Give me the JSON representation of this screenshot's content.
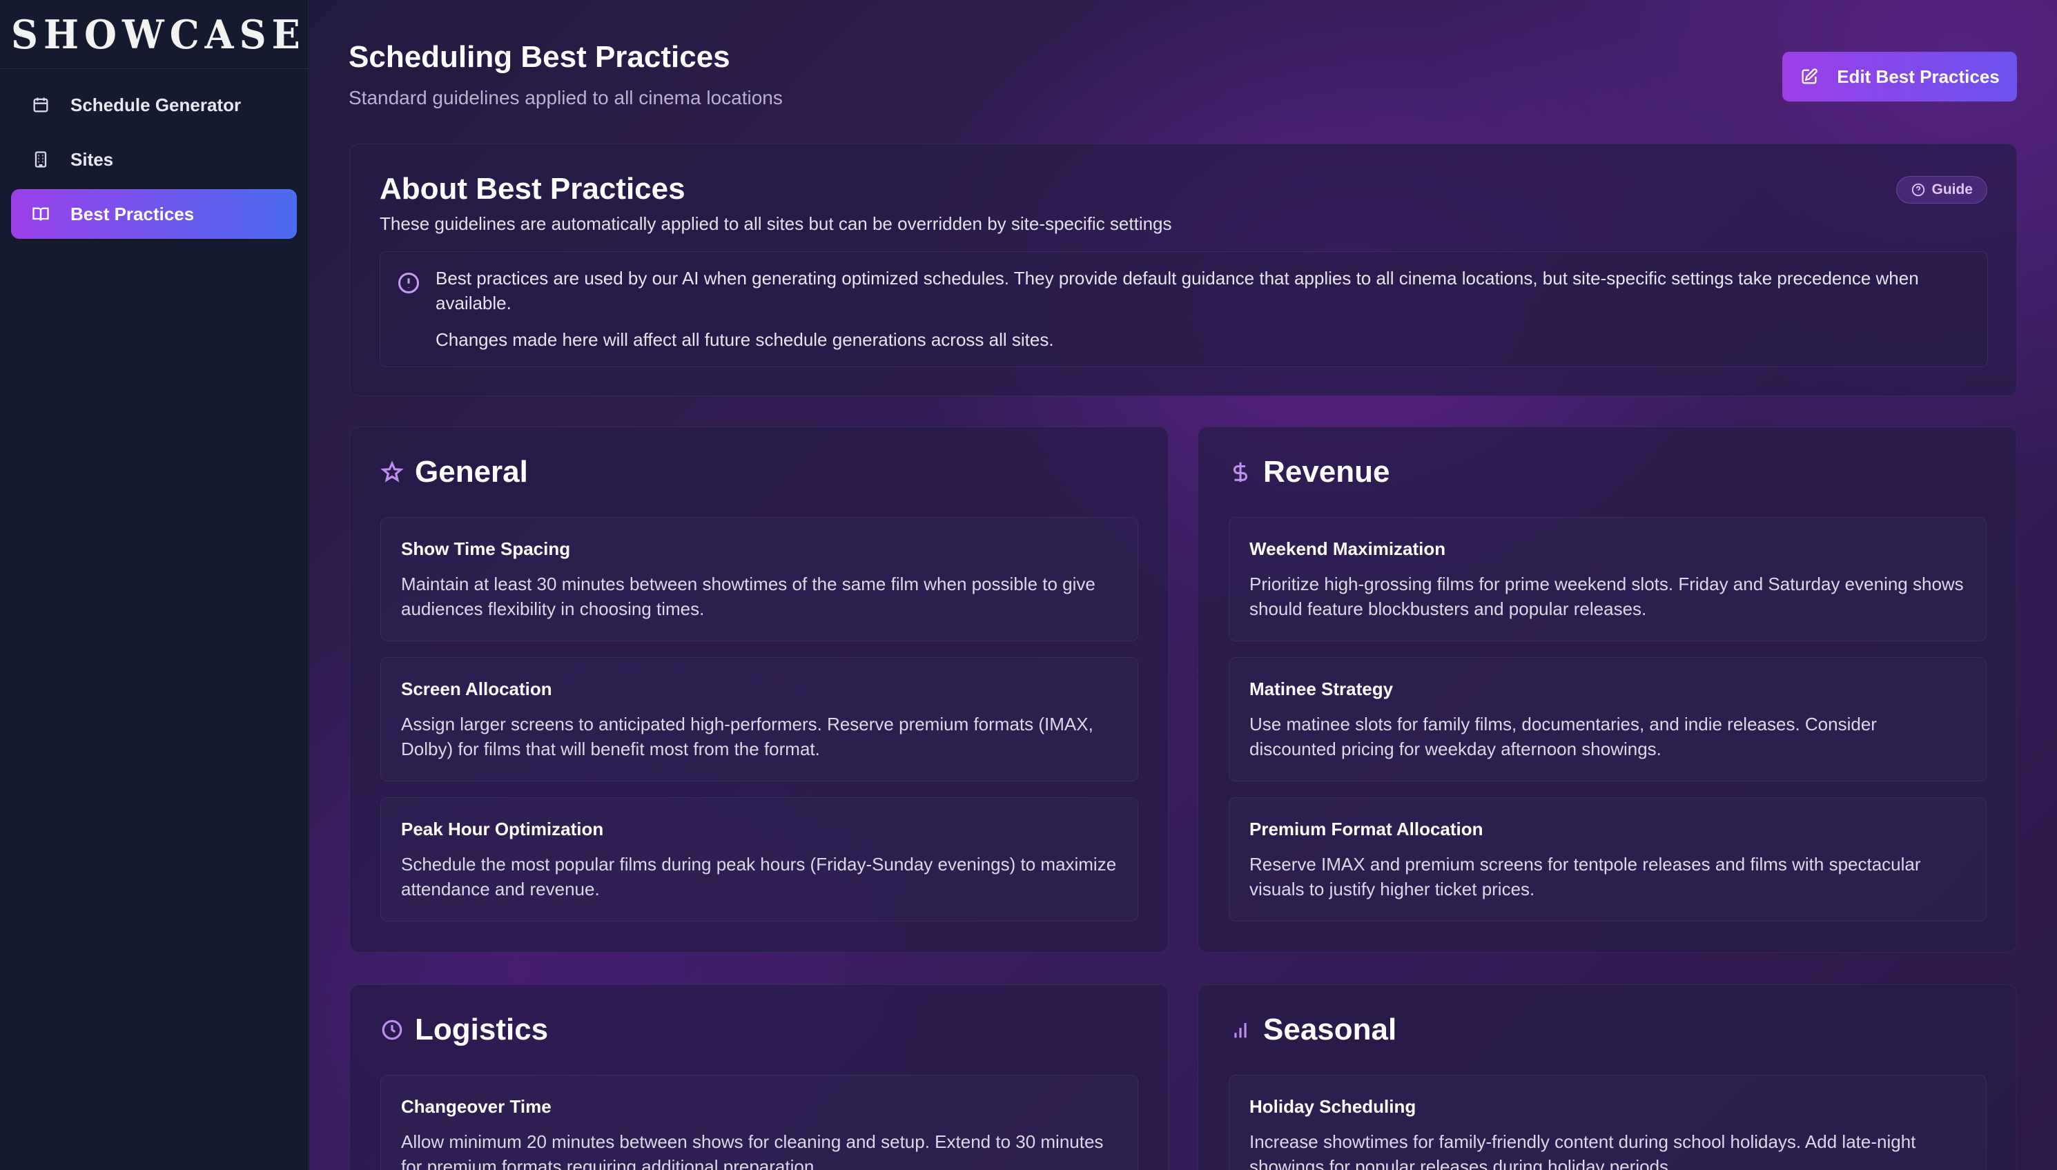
{
  "brand": {
    "logo_text": "SHOWCASE"
  },
  "sidebar": {
    "items": [
      {
        "label": "Schedule Generator",
        "icon": "calendar-icon",
        "active": false
      },
      {
        "label": "Sites",
        "icon": "building-icon",
        "active": false
      },
      {
        "label": "Best Practices",
        "icon": "book-open-icon",
        "active": true
      }
    ]
  },
  "header": {
    "title": "Scheduling Best Practices",
    "subtitle": "Standard guidelines applied to all cinema locations",
    "edit_button_label": "Edit Best Practices",
    "edit_button_icon": "edit-icon"
  },
  "about": {
    "title": "About Best Practices",
    "description": "These guidelines are automatically applied to all sites but can be overridden by site-specific settings",
    "badge": "Guide",
    "info_line_1": "Best practices are used by our AI when generating optimized schedules. They provide default guidance that applies to all cinema locations, but site-specific settings take precedence when available.",
    "info_line_2": "Changes made here will affect all future schedule generations across all sites."
  },
  "sections": {
    "general": {
      "title": "General",
      "icon": "star-icon",
      "items": [
        {
          "title": "Show Time Spacing",
          "description": "Maintain at least 30 minutes between showtimes of the same film when possible to give audiences flexibility in choosing times."
        },
        {
          "title": "Screen Allocation",
          "description": "Assign larger screens to anticipated high-performers. Reserve premium formats (IMAX, Dolby) for films that will benefit most from the format."
        },
        {
          "title": "Peak Hour Optimization",
          "description": "Schedule the most popular films during peak hours (Friday-Sunday evenings) to maximize attendance and revenue."
        }
      ]
    },
    "revenue": {
      "title": "Revenue",
      "icon": "dollar-icon",
      "items": [
        {
          "title": "Weekend Maximization",
          "description": "Prioritize high-grossing films for prime weekend slots. Friday and Saturday evening shows should feature blockbusters and popular releases."
        },
        {
          "title": "Matinee Strategy",
          "description": "Use matinee slots for family films, documentaries, and indie releases. Consider discounted pricing for weekday afternoon showings."
        },
        {
          "title": "Premium Format Allocation",
          "description": "Reserve IMAX and premium screens for tentpole releases and films with spectacular visuals to justify higher ticket prices."
        }
      ]
    },
    "logistics": {
      "title": "Logistics",
      "icon": "clock-icon",
      "items": [
        {
          "title": "Changeover Time",
          "description": "Allow minimum 20 minutes between shows for cleaning and setup. Extend to 30 minutes for premium formats requiring additional preparation."
        }
      ]
    },
    "seasonal": {
      "title": "Seasonal",
      "icon": "bar-chart-icon",
      "items": [
        {
          "title": "Holiday Scheduling",
          "description": "Increase showtimes for family-friendly content during school holidays. Add late-night showings for popular releases during holiday periods."
        }
      ]
    }
  },
  "colors": {
    "accent_start": "#9b3fe8",
    "accent_end": "#4a6cf0",
    "icon_accent": "#c08ef0",
    "sidebar_bg": "#151a30"
  }
}
